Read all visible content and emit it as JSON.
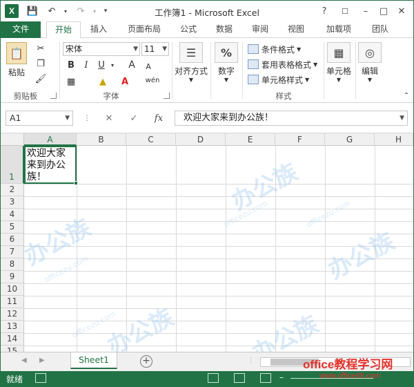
{
  "app": {
    "title": "工作簿1 - Microsoft Excel",
    "logo": "X",
    "quick_access": [
      "save-icon",
      "undo-icon",
      "redo-icon",
      "customize-icon"
    ],
    "window_buttons": [
      "?",
      "☐",
      "–",
      "□",
      "✕"
    ]
  },
  "ribbon": {
    "tabs": [
      {
        "label": "文件"
      },
      {
        "label": "开始"
      },
      {
        "label": "插入"
      },
      {
        "label": "页面布局"
      },
      {
        "label": "公式"
      },
      {
        "label": "数据"
      },
      {
        "label": "审阅"
      },
      {
        "label": "视图"
      },
      {
        "label": "加载项"
      },
      {
        "label": "团队"
      }
    ],
    "active_tab": "开始",
    "groups": {
      "clipboard": {
        "label": "剪贴板",
        "paste_label": "粘贴"
      },
      "font": {
        "label": "字体",
        "font_name": "宋体",
        "font_size": "11",
        "bold": "B",
        "italic": "I",
        "underline": "U",
        "grow": "A",
        "shrink": "A",
        "font_color": "A",
        "wen": "wén"
      },
      "alignment": {
        "label": "对齐方式"
      },
      "number": {
        "label": "数字",
        "symbol": "%"
      },
      "styles": {
        "label": "样式",
        "items": [
          "条件格式",
          "套用表格格式",
          "单元格样式"
        ]
      },
      "cells": {
        "label": "单元格"
      },
      "editing": {
        "label": "编辑"
      }
    }
  },
  "formula_bar": {
    "name_box": "A1",
    "fx": "fx",
    "content": "欢迎大家来到办公族！"
  },
  "grid": {
    "columns": [
      "A",
      "B",
      "C",
      "D",
      "E",
      "F",
      "G",
      "H"
    ],
    "rows": [
      "1",
      "2",
      "3",
      "4",
      "5",
      "6",
      "7",
      "8",
      "9",
      "10",
      "11",
      "12",
      "13",
      "14",
      "15"
    ],
    "cell_a1": "欢迎大家来到办公族！"
  },
  "sheets": {
    "tabs": [
      "Sheet1"
    ],
    "add_label": "+"
  },
  "status": {
    "text": "就绪"
  },
  "watermark": {
    "brand": "office教程学习网",
    "url": "www.office68.com",
    "site": "officezu.com",
    "logo_text": "办公族"
  },
  "colors": {
    "accent": "#217346",
    "brand_red": "#e4322b"
  }
}
